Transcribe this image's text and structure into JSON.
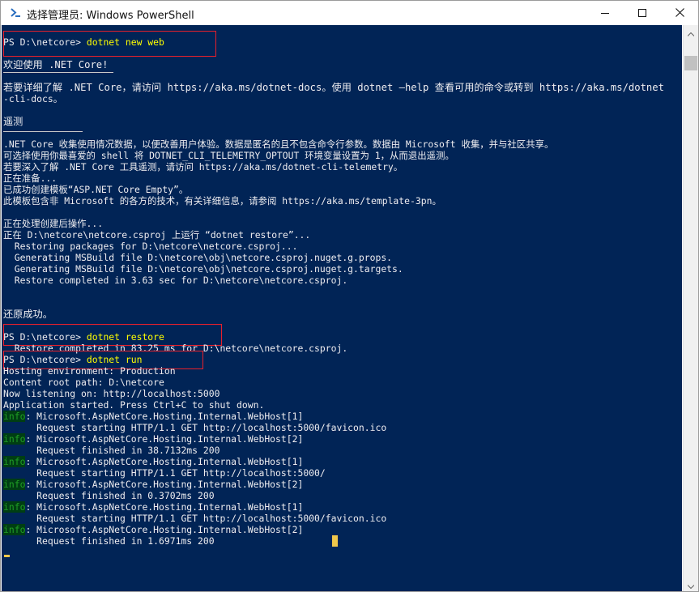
{
  "window": {
    "title": "选择管理员: Windows PowerShell",
    "icons": {
      "app": "powershell-icon",
      "minimize": "minimize-icon",
      "maximize": "maximize-icon",
      "close": "close-icon"
    }
  },
  "colors": {
    "background": "#012456",
    "text": "#eeedf0",
    "command": "#ffff00",
    "info": "#1f9e24",
    "highlight_box": "#e8202a",
    "cursor": "#f0c74b"
  },
  "console": {
    "l01_prompt": "PS D:\\netcore> ",
    "l01_cmd": "dotnet new web",
    "l02": "欢迎使用 .NET Core!",
    "l03": "若要详细了解 .NET Core，请访问 https://aka.ms/dotnet-docs。使用 dotnet —help 查看可用的命令或转到 https://aka.ms/dotnet",
    "l04": "-cli-docs。",
    "l05": "遥测",
    "l06": ".NET Core 收集使用情况数据，以便改善用户体验。数据是匿名的且不包含命令行参数。数据由 Microsoft 收集，并与社区共享。",
    "l07": "可选择使用你最喜爱的 shell 将 DOTNET_CLI_TELEMETRY_OPTOUT 环境变量设置为 1，从而退出遥测。",
    "l08": "若要深入了解 .NET Core 工具遥测，请访问 https://aka.ms/dotnet-cli-telemetry。",
    "l09": "正在准备...",
    "l10": "已成功创建模板“ASP.NET Core Empty”。",
    "l11": "此模板包含非 Microsoft 的各方的技术，有关详细信息，请参阅 https://aka.ms/template-3pn。",
    "l12": "正在处理创建后操作...",
    "l13": "正在 D:\\netcore\\netcore.csproj 上运行 “dotnet restore”...",
    "l14": "  Restoring packages for D:\\netcore\\netcore.csproj...",
    "l15": "  Generating MSBuild file D:\\netcore\\obj\\netcore.csproj.nuget.g.props.",
    "l16": "  Generating MSBuild file D:\\netcore\\obj\\netcore.csproj.nuget.g.targets.",
    "l17": "  Restore completed in 3.63 sec for D:\\netcore\\netcore.csproj.",
    "l18": "还原成功。",
    "l19_prompt": "PS D:\\netcore> ",
    "l19_cmd": "dotnet restore",
    "l20": "  Restore completed in 83.25 ms for D:\\netcore\\netcore.csproj.",
    "l21_prompt": "PS D:\\netcore> ",
    "l21_cmd": "dotnet run",
    "l22": "Hosting environment: Production",
    "l23": "Content root path: D:\\netcore",
    "l24": "Now listening on: http://localhost:5000",
    "l25": "Application started. Press Ctrl+C to shut down.",
    "info_tag": "info",
    "log_source_1": ": Microsoft.AspNetCore.Hosting.Internal.WebHost[1]",
    "log_source_2": ": Microsoft.AspNetCore.Hosting.Internal.WebHost[2]",
    "l27": "      Request starting HTTP/1.1 GET http://localhost:5000/favicon.ico",
    "l29": "      Request finished in 38.7132ms 200",
    "l31": "      Request starting HTTP/1.1 GET http://localhost:5000/",
    "l33": "      Request finished in 0.3702ms 200",
    "l35": "      Request starting HTTP/1.1 GET http://localhost:5000/favicon.ico",
    "l37": "      Request finished in 1.6971ms 200"
  },
  "scrollbar": {
    "up_icon": "scroll-up-arrow-icon",
    "down_icon": "scroll-down-arrow-icon"
  }
}
